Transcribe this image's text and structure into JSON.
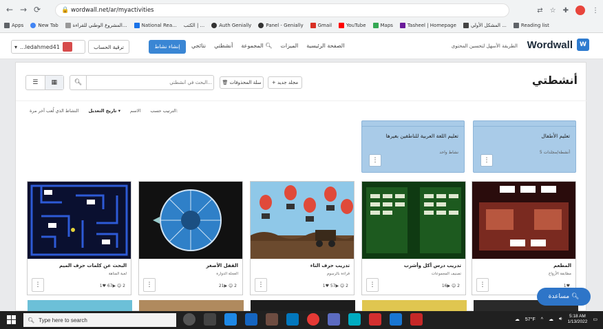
{
  "browser": {
    "url": "wordwall.net/ar/myactivities",
    "bookmarks": [
      "Apps",
      "New Tab",
      "المشروع الوطني للقراءة...",
      "National Rea...",
      "الكتب | ...",
      "Auth Genially",
      "Panel - Genially",
      "Gmail",
      "YouTube",
      "Maps",
      "Tasheel | Homepage",
      "المشكل الأولي ...",
      "Reading list"
    ]
  },
  "header": {
    "user_name": "...ledahmed41",
    "account_button": "ترقية الحساب",
    "create_button": "إنشاء نشاط",
    "nav": [
      "الصفحة الرئيسية",
      "الميزات",
      "المجموعة",
      "أنشطتي",
      "نتائجي"
    ],
    "tagline": "الطريقة الأسهل لتحسين المحتوى",
    "logo": "Wordwall"
  },
  "toolbar": {
    "page_title": "أنشطتي",
    "search_placeholder": "البحث في أنشطتي...",
    "recycle_bin": "سلة المحذوفات",
    "new_folder": "مجلد جديد"
  },
  "sort": {
    "label": "الترتيب حسب:",
    "options": [
      "الاسم",
      "تاريخ التعديل",
      "النشاط الذي لُعب آخر مرة"
    ]
  },
  "folders": [
    {
      "name": "تعليم الأطفال",
      "count": "5 أنشطة/مجلدات"
    },
    {
      "name": "تعليم اللغة العربية للناطقين بغيرها",
      "count": "نشاط واحد"
    }
  ],
  "activities": [
    {
      "title": "المطعم",
      "type": "مطابقة الأزواج",
      "stats": "1♥"
    },
    {
      "title": "تدريب درس أكل وأشرب",
      "type": "تصنيف المجموعات",
      "stats": "16▶  ☺ 2"
    },
    {
      "title": "تدريب حرف التاء",
      "type": "قراءة بالرسوم",
      "stats": "1♥  57▶  ☺ 2"
    },
    {
      "title": "القفل الأصغر",
      "type": "العجلة الدوارة",
      "stats": "21▶  ☺ 2"
    },
    {
      "title": "البحث عن كلمات حرف الميم",
      "type": "لعبة المتاهة",
      "stats": "1♥  67▶  ☺ 2"
    }
  ],
  "help_button": "مساعدة",
  "taskbar": {
    "search_placeholder": "Type here to search",
    "weather": "57°F",
    "time": "5:18 AM",
    "date": "1/13/2022"
  },
  "colors": {
    "folder": "#a9cbe8",
    "primary": "#3a86d4",
    "taskbar": "#202020"
  }
}
